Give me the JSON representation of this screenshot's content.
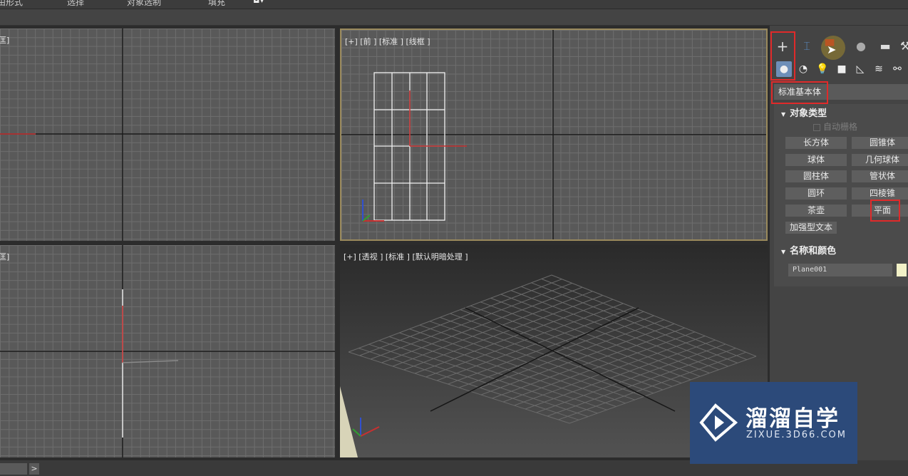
{
  "menubar": {
    "items": [
      "由形式",
      "选择",
      "对象选制",
      "填充"
    ]
  },
  "viewports": {
    "top_left": {
      "label": "匡]"
    },
    "front": {
      "label": "[+] [前 ] [标准 ] [线框 ]"
    },
    "bottom_left": {
      "label": "匡]"
    },
    "perspective": {
      "label": "[+] [透视 ] [标准 ] [默认明暗处理 ]"
    }
  },
  "command_panel": {
    "tabs": [
      {
        "icon": "create-plus-icon",
        "glyph": "+"
      },
      {
        "icon": "modify-icon",
        "glyph": "⌶"
      },
      {
        "icon": "hierarchy-icon",
        "glyph": "▀"
      },
      {
        "icon": "motion-icon",
        "glyph": "●"
      },
      {
        "icon": "display-icon",
        "glyph": "▬"
      },
      {
        "icon": "utilities-icon",
        "glyph": "⚒"
      }
    ],
    "subtabs": [
      {
        "icon": "geometry-icon",
        "glyph": "●"
      },
      {
        "icon": "shapes-icon",
        "glyph": "◔"
      },
      {
        "icon": "lights-icon",
        "glyph": "💡"
      },
      {
        "icon": "cameras-icon",
        "glyph": "■"
      },
      {
        "icon": "helpers-icon",
        "glyph": "◺"
      },
      {
        "icon": "spacewarps-icon",
        "glyph": "≋"
      },
      {
        "icon": "systems-icon",
        "glyph": "⚯"
      }
    ],
    "category_dropdown": "标准基本体",
    "object_type": {
      "title": "对象类型",
      "autogrid_label": "自动栅格",
      "buttons": [
        "长方体",
        "圆锥体",
        "球体",
        "几何球体",
        "圆柱体",
        "管状体",
        "圆环",
        "四棱锥",
        "茶壶",
        "平面",
        "加强型文本"
      ]
    },
    "name_color": {
      "title": "名称和颜色",
      "name_value": "Plane001",
      "swatch_color": "#f2f1c7"
    }
  },
  "statusbar": {
    "arrow": ">"
  },
  "watermark": {
    "cn_text": "溜溜自学",
    "en_text": "ZIXUE.3D66.COM"
  },
  "colors": {
    "highlight_box": "#e02a2a",
    "active_viewport_border": "#9a8a5c",
    "logo_bg": "#2c4a7a"
  }
}
